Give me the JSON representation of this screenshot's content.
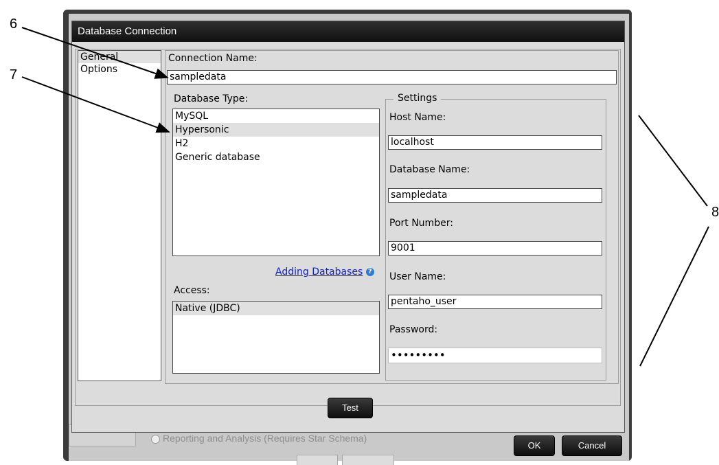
{
  "callouts": {
    "c6": "6",
    "c7": "7",
    "c8": "8"
  },
  "background": {
    "radio_text": "Reporting and Analysis (Requires Star Schema)"
  },
  "dialog": {
    "title": "Database Connection",
    "nav": [
      "General",
      "Options"
    ],
    "connection_name_label": "Connection Name:",
    "connection_name_value": "sampledata",
    "database_type_label": "Database Type:",
    "database_types": [
      "MySQL",
      "Hypersonic",
      "H2",
      "Generic database"
    ],
    "selected_database_type": "Hypersonic",
    "adding_databases_link": "Adding Databases",
    "access_label": "Access:",
    "access_options": [
      "Native (JDBC)"
    ],
    "settings": {
      "legend": "Settings",
      "host_name_label": "Host Name:",
      "host_name_value": "localhost",
      "database_name_label": "Database Name:",
      "database_name_value": "sampledata",
      "port_number_label": "Port Number:",
      "port_number_value": "9001",
      "user_name_label": "User Name:",
      "user_name_value": "pentaho_user",
      "password_label": "Password:",
      "password_value": "•••••••••"
    },
    "test_button": "Test"
  },
  "footer": {
    "ok_button": "OK",
    "cancel_button": "Cancel"
  },
  "colors": {
    "titlebar": "#111111",
    "link": "#1020d0",
    "panel": "#dcdcdc"
  }
}
